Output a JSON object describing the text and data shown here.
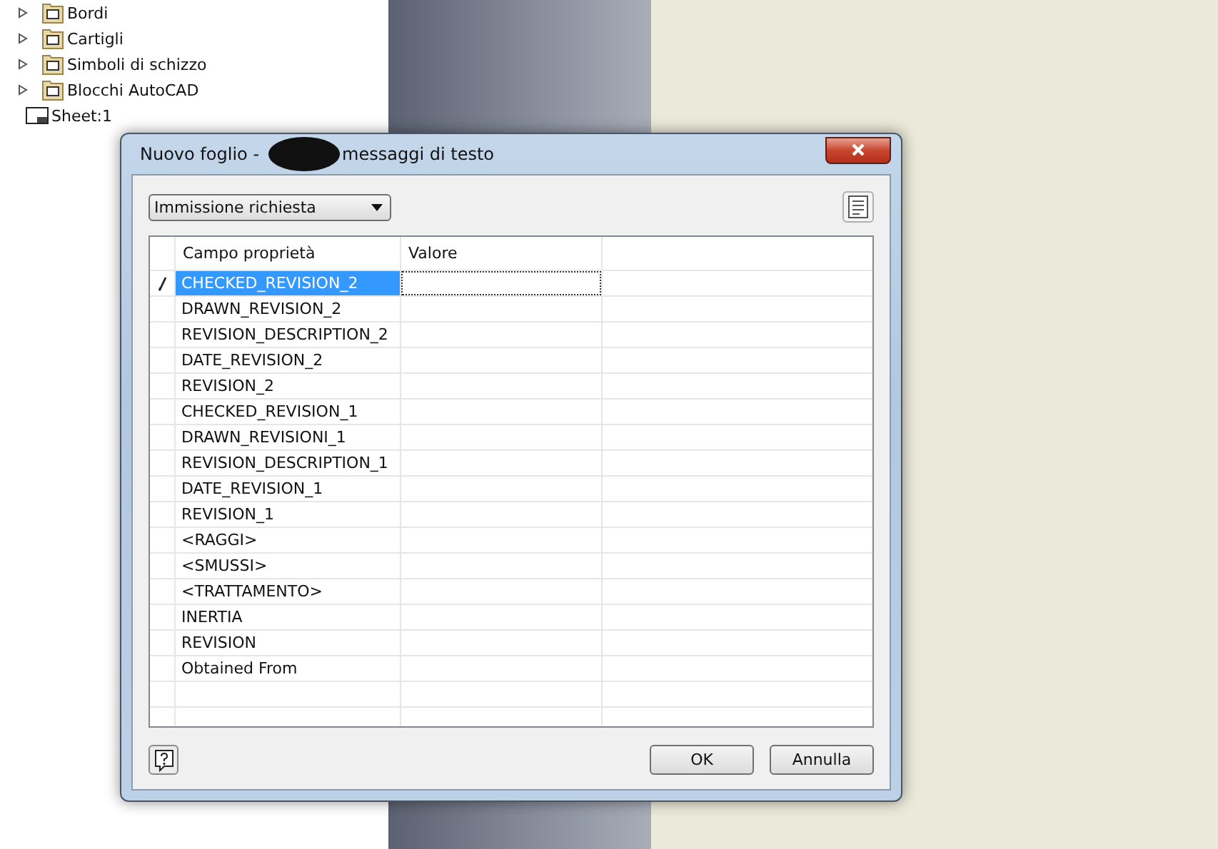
{
  "tree": {
    "items": [
      {
        "label": "Bordi",
        "kind": "folder",
        "expanded": false
      },
      {
        "label": "Cartigli",
        "kind": "folder",
        "expanded": false
      },
      {
        "label": "Simboli di schizzo",
        "kind": "folder",
        "expanded": false
      },
      {
        "label": "Blocchi AutoCAD",
        "kind": "folder",
        "expanded": false
      },
      {
        "label": "Sheet:1",
        "kind": "sheet"
      }
    ]
  },
  "dialog": {
    "title_start": "Nuovo foglio -",
    "title_end": "messaggi di testo",
    "filter": {
      "value": "Immissione richiesta"
    },
    "table": {
      "columns": [
        "Campo proprietà",
        "Valore"
      ],
      "rows": [
        {
          "field": "CHECKED_REVISION_2",
          "selected": true
        },
        {
          "field": "DRAWN_REVISION_2",
          "selected": false
        },
        {
          "field": "REVISION_DESCRIPTION_2",
          "selected": false
        },
        {
          "field": "DATE_REVISION_2",
          "selected": false
        },
        {
          "field": "REVISION_2",
          "selected": false
        },
        {
          "field": "CHECKED_REVISION_1",
          "selected": false
        },
        {
          "field": "DRAWN_REVISIONI_1",
          "selected": false
        },
        {
          "field": "REVISION_DESCRIPTION_1",
          "selected": false
        },
        {
          "field": "DATE_REVISION_1",
          "selected": false
        },
        {
          "field": "REVISION_1",
          "selected": false
        },
        {
          "field": "<RAGGI>",
          "selected": false
        },
        {
          "field": "<SMUSSI>",
          "selected": false
        },
        {
          "field": "<TRATTAMENTO>",
          "selected": false
        },
        {
          "field": "INERTIA",
          "selected": false
        },
        {
          "field": "REVISION",
          "selected": false
        },
        {
          "field": "Obtained From",
          "selected": false
        }
      ]
    },
    "buttons": [
      "OK",
      "Annulla"
    ]
  }
}
